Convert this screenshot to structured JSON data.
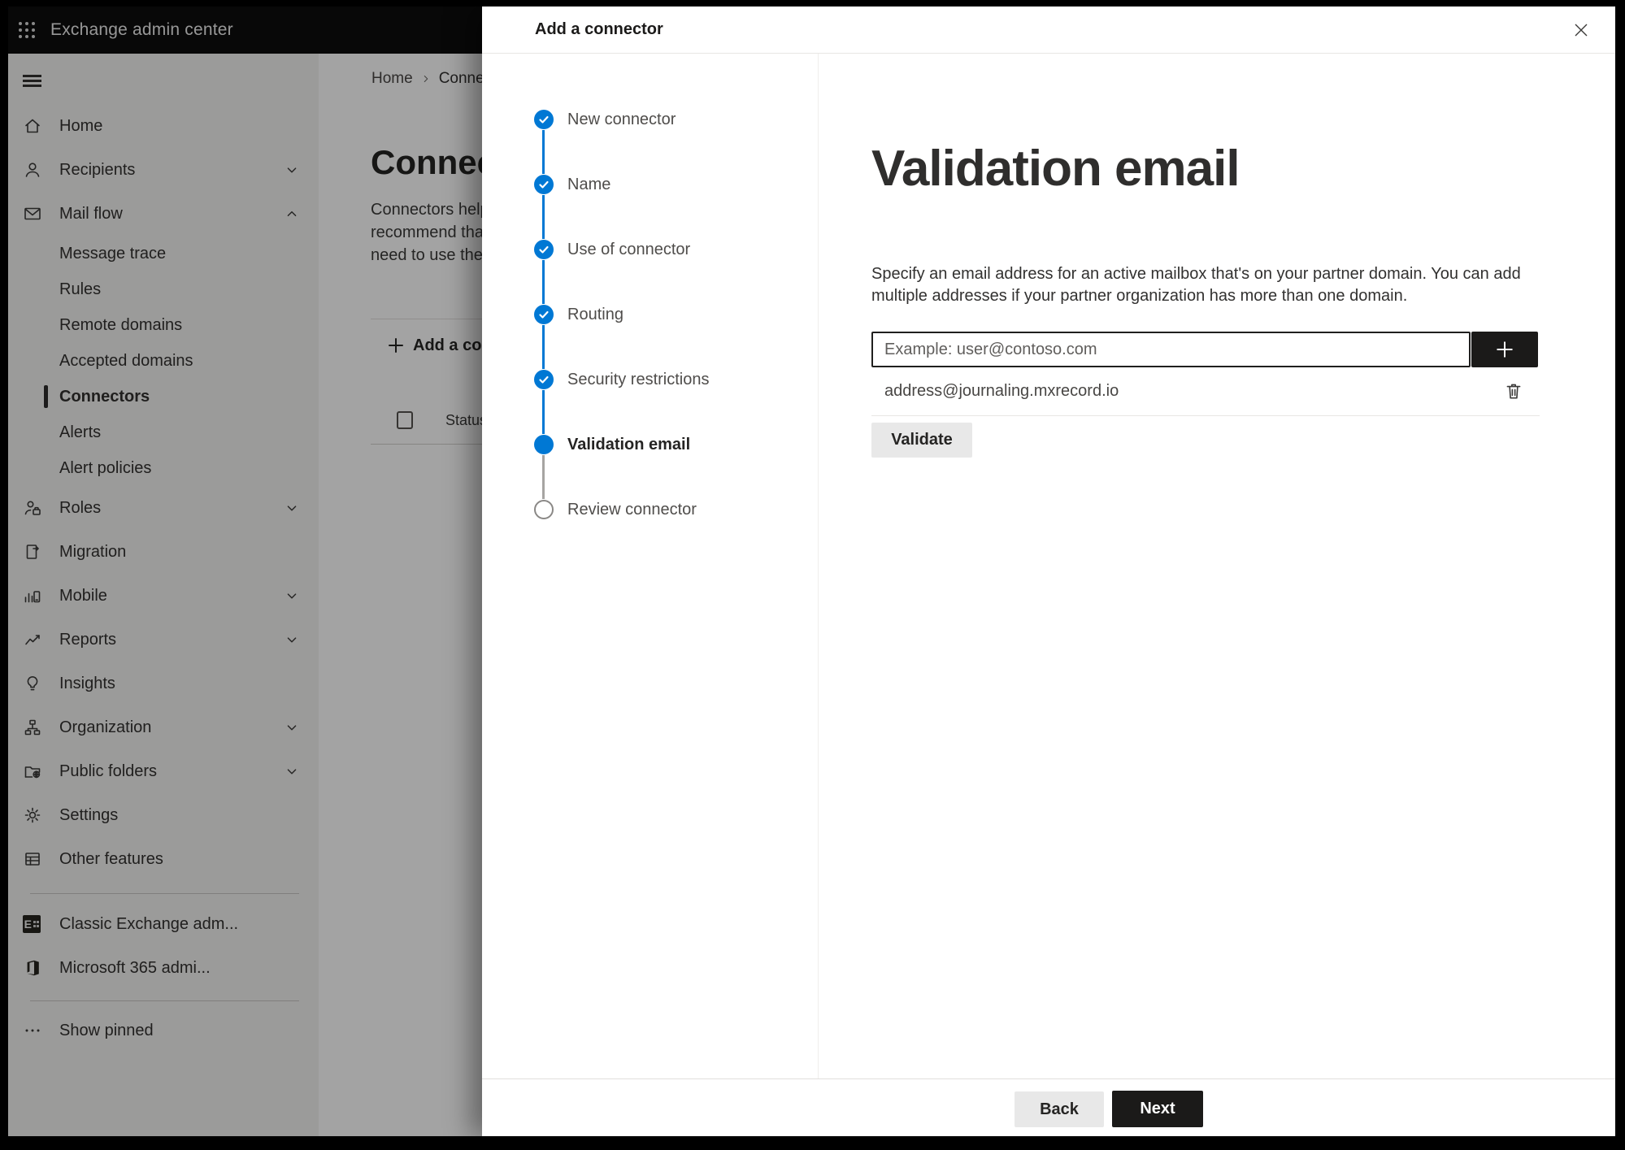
{
  "topbar": {
    "app_title": "Exchange admin center"
  },
  "sidebar": {
    "items": [
      {
        "label": "Home"
      },
      {
        "label": "Recipients"
      },
      {
        "label": "Mail flow"
      },
      {
        "label": "Message trace"
      },
      {
        "label": "Rules"
      },
      {
        "label": "Remote domains"
      },
      {
        "label": "Accepted domains"
      },
      {
        "label": "Connectors"
      },
      {
        "label": "Alerts"
      },
      {
        "label": "Alert policies"
      },
      {
        "label": "Roles"
      },
      {
        "label": "Migration"
      },
      {
        "label": "Mobile"
      },
      {
        "label": "Reports"
      },
      {
        "label": "Insights"
      },
      {
        "label": "Organization"
      },
      {
        "label": "Public folders"
      },
      {
        "label": "Settings"
      },
      {
        "label": "Other features"
      },
      {
        "label": "Classic Exchange adm..."
      },
      {
        "label": "Microsoft 365 admi..."
      },
      {
        "label": "Show pinned"
      }
    ]
  },
  "page": {
    "breadcrumb": {
      "home": "Home",
      "current": "Conne"
    },
    "title": "Connec",
    "description_lines": [
      "Connectors help",
      "recommend that",
      "need to use ther"
    ],
    "add_connector_label": "Add a conn",
    "table": {
      "status_header": "Status"
    }
  },
  "modal": {
    "title": "Add a connector",
    "steps": [
      {
        "label": "New connector",
        "state": "complete"
      },
      {
        "label": "Name",
        "state": "complete"
      },
      {
        "label": "Use of connector",
        "state": "complete"
      },
      {
        "label": "Routing",
        "state": "complete"
      },
      {
        "label": "Security restrictions",
        "state": "complete"
      },
      {
        "label": "Validation email",
        "state": "current"
      },
      {
        "label": "Review connector",
        "state": "upcoming"
      }
    ],
    "content": {
      "heading": "Validation email",
      "description_lines": [
        "Specify an email address for an active mailbox that's on your partner domain. You can add",
        "multiple addresses if your partner organization has more than one domain."
      ],
      "input_placeholder": "Example: user@contoso.com",
      "added_address": "address@journaling.mxrecord.io",
      "validate_label": "Validate"
    },
    "footer": {
      "back_label": "Back",
      "next_label": "Next"
    }
  },
  "colors": {
    "accent": "#0078d4",
    "dark_button": "#1b1a19"
  }
}
